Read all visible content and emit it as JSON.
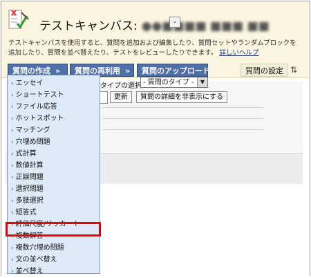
{
  "header": {
    "title_prefix": "テストキャンバス:",
    "title_name": "●●■■■■ ■■■ ■■",
    "description": "テストキャンバスを使用すると、質問を追加および編集したり、質問セットやランダムブロックを追加したり、質問を並べ替えたり、テストをレビューしたりできます。",
    "help_link": "詳しいヘルプ"
  },
  "toolbar": {
    "create_label": "質問の作成",
    "reuse_label": "質問の再利用",
    "upload_label": "質問のアップロード",
    "settings_label": "質問の設定",
    "chevron": "»"
  },
  "filter": {
    "type_label": "タイプの選択:",
    "type_select": "- 質問のタイプ -",
    "update_label": "更新",
    "hide_details_label": "質問の詳細を非表示にする"
  },
  "dropdown": {
    "marker": "›",
    "items": [
      {
        "label": "エッセイ"
      },
      {
        "label": "ショートテスト"
      },
      {
        "label": "ファイル応答"
      },
      {
        "label": "ホットスポット"
      },
      {
        "label": "マッチング"
      },
      {
        "label": "穴埋め問題"
      },
      {
        "label": "式計算"
      },
      {
        "label": "数値計算"
      },
      {
        "label": "正誤問題"
      },
      {
        "label": "選択問題"
      },
      {
        "label": "多肢選択"
      },
      {
        "label": "短答式"
      },
      {
        "label": "評価尺度/リッカート"
      },
      {
        "label": "複数解答"
      },
      {
        "label": "複数穴埋め問題"
      },
      {
        "label": "文の並べ替え"
      },
      {
        "label": "並べ替え"
      }
    ]
  },
  "colors": {
    "header_bg": "#fcf6e0",
    "toolbar_button": "#4f6fa7",
    "dropdown_bg": "#dfeaf8",
    "highlight": "#e00012"
  }
}
